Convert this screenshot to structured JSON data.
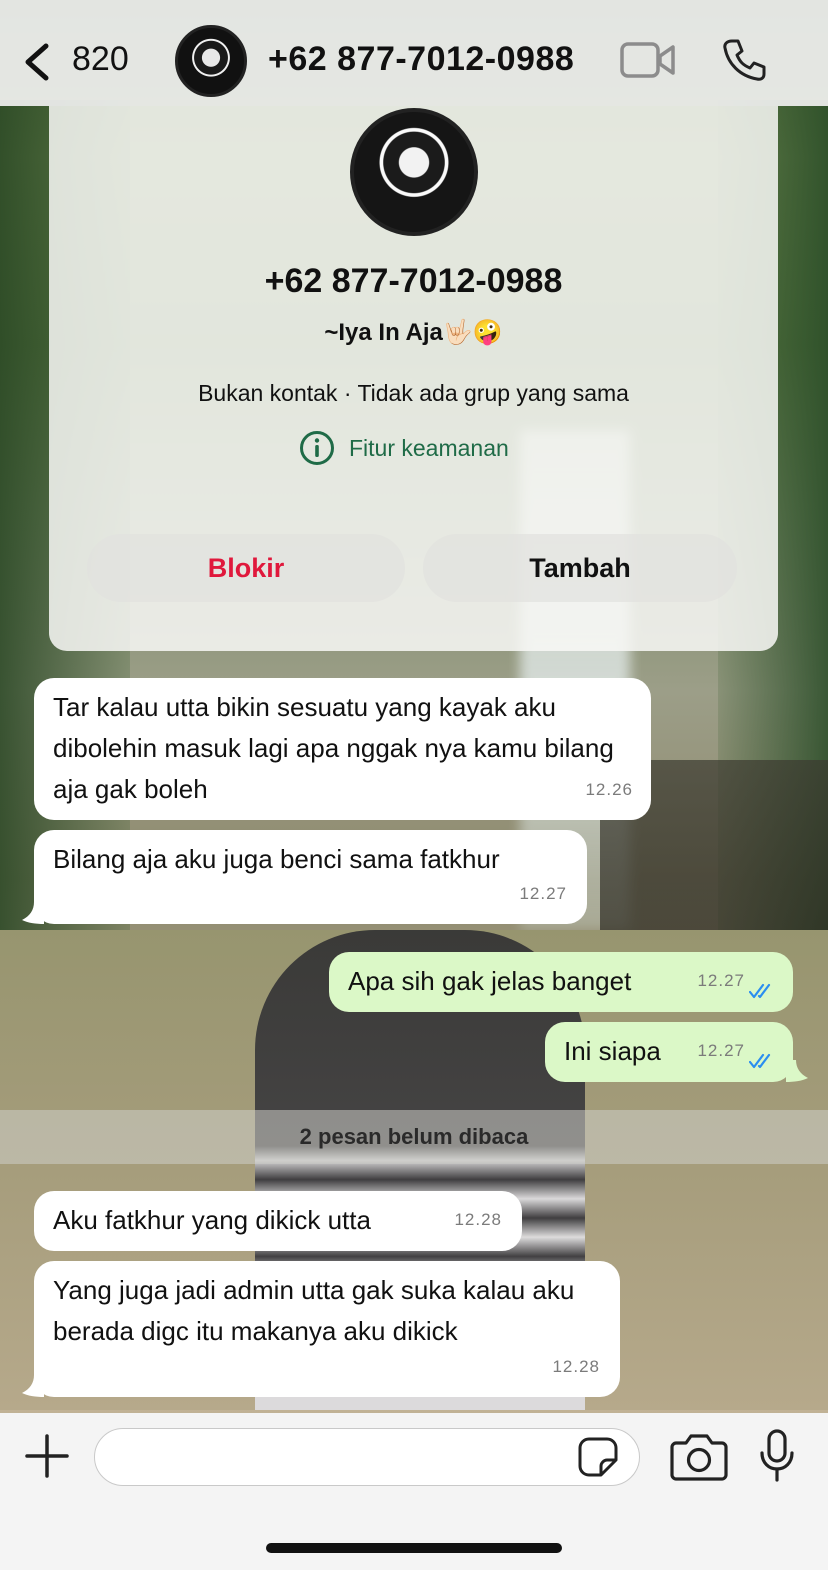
{
  "header": {
    "back_count": "820",
    "contact_title": "+62 877-7012-0988"
  },
  "info_card": {
    "phone": "+62 877-7012-0988",
    "about": "~Iya In Aja🤟🏻🤪",
    "subtitle": "Bukan kontak · Tidak ada grup yang sama",
    "security_label": "Fitur keamanan",
    "block_label": "Blokir",
    "add_label": "Tambah"
  },
  "messages": [
    {
      "direction": "in",
      "text": "Tar kalau utta bikin sesuatu yang kayak aku dibolehin masuk lagi apa nggak nya kamu bilang aja gak boleh",
      "time": "12.26"
    },
    {
      "direction": "in",
      "text": "Bilang aja aku juga benci sama fatkhur",
      "time": "12.27"
    },
    {
      "direction": "out",
      "text": "Apa sih gak jelas banget",
      "time": "12.27",
      "status": "read"
    },
    {
      "direction": "out",
      "text": "Ini siapa",
      "time": "12.27",
      "status": "read"
    },
    {
      "direction": "in",
      "text": "Aku fatkhur yang dikick utta",
      "time": "12.28"
    },
    {
      "direction": "in",
      "text": "Yang juga jadi admin utta gak suka kalau aku berada digc itu makanya aku dikick",
      "time": "12.28"
    }
  ],
  "unread_divider": "2 pesan belum dibaca",
  "input": {
    "value": "",
    "placeholder": ""
  },
  "colors": {
    "accent_green": "#1f6b47",
    "block_red": "#e0183c",
    "outgoing_bubble": "#dbf8c7",
    "incoming_bubble": "#ffffff",
    "read_ticks": "#2a8ef0"
  },
  "icons": [
    "chevron-left-icon",
    "video-camera-icon",
    "phone-icon",
    "info-icon",
    "plus-icon",
    "sticker-icon",
    "camera-icon",
    "microphone-icon"
  ]
}
